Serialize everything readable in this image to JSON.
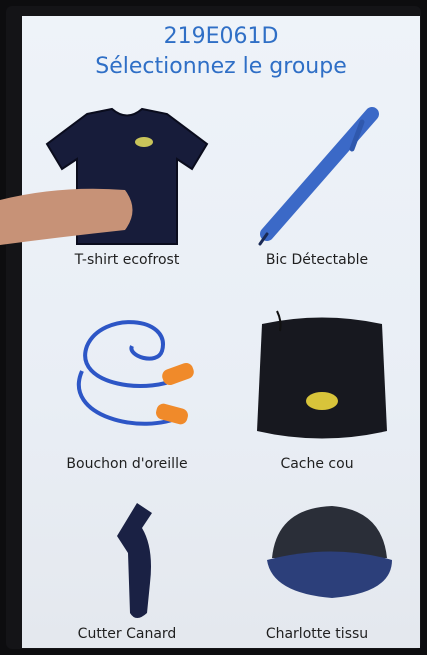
{
  "header": {
    "code": "219E061D",
    "subtitle": "Sélectionnez le groupe"
  },
  "items": [
    {
      "label": "T-shirt ecofrost",
      "icon": "tshirt-icon"
    },
    {
      "label": "Bic Détectable",
      "icon": "pen-icon"
    },
    {
      "label": "Bouchon d'oreille",
      "icon": "earplugs-icon"
    },
    {
      "label": "Cache cou",
      "icon": "neck-warmer-icon"
    },
    {
      "label": "Cutter Canard",
      "icon": "cutter-icon"
    },
    {
      "label": "Charlotte tissu",
      "icon": "cap-icon"
    }
  ],
  "colors": {
    "accent": "#2f6fc6",
    "navy": "#171c3a",
    "pen_blue": "#3b69c7",
    "earplug_orange": "#f08a2a"
  }
}
